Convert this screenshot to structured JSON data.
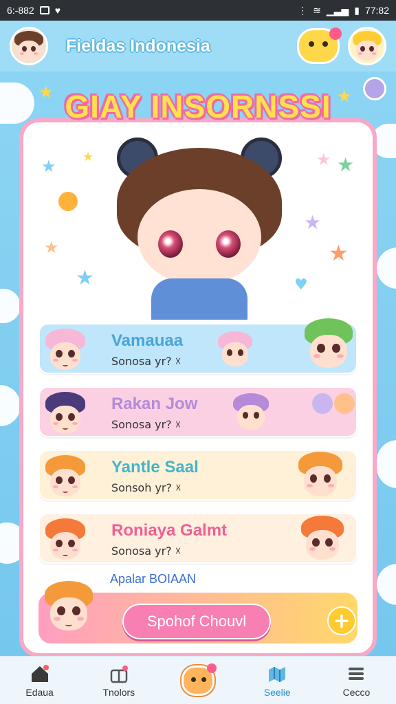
{
  "status_bar": {
    "time_left": "6:-882",
    "time_right": "77:82"
  },
  "app": {
    "title": "Fieldas Indonesia"
  },
  "headline": "GIAY INSORNSSI",
  "chats": [
    {
      "name": "Vamauaa",
      "preview": "Sonosa yr? ☓",
      "name_color": "#4aa3d8",
      "bg": "#bfe6fb",
      "hair": "#f7b7d6",
      "hair2": "#f2a9c8",
      "hair3": "#6fc35a"
    },
    {
      "name": "Rakan Jow",
      "preview": "Sonosa yr? ☓",
      "name_color": "#b38bd9",
      "bg": "#fbd0e3",
      "hair": "#4c3b7a",
      "hair2": "#6b3f2a",
      "hair3": "#b48ad9"
    },
    {
      "name": "Yantle Saal",
      "preview": "Sonsoh yr? ☓",
      "name_color": "#41b6c8",
      "bg": "#fff1d7",
      "hair": "#f59a3a",
      "hair2": "#5d8f42",
      "hair3": "#f59a3a"
    },
    {
      "name": "Roniaya Galmt",
      "preview": "Sonosa yr? ☓",
      "name_color": "#f15f92",
      "bg": "#fff0e0",
      "hair": "#f57a3a",
      "hair2": "#f7b7d6",
      "hair3": "#f57a3a"
    }
  ],
  "small_label": "Apalar BOIAAN",
  "chat_button": "Spohof Chouvl",
  "plus_label": "+",
  "nav": [
    {
      "label": "Edaua",
      "icon": "home-icon"
    },
    {
      "label": "Tnolors",
      "icon": "gift-icon"
    },
    {
      "label": "",
      "icon": "mascot-icon"
    },
    {
      "label": "Seelie",
      "icon": "map-icon"
    },
    {
      "label": "Cecco",
      "icon": "menu-icon"
    }
  ],
  "colors": {
    "accent_pink": "#f06aa5",
    "accent_yellow": "#ffe14d",
    "sky": "#8fd6f4"
  }
}
